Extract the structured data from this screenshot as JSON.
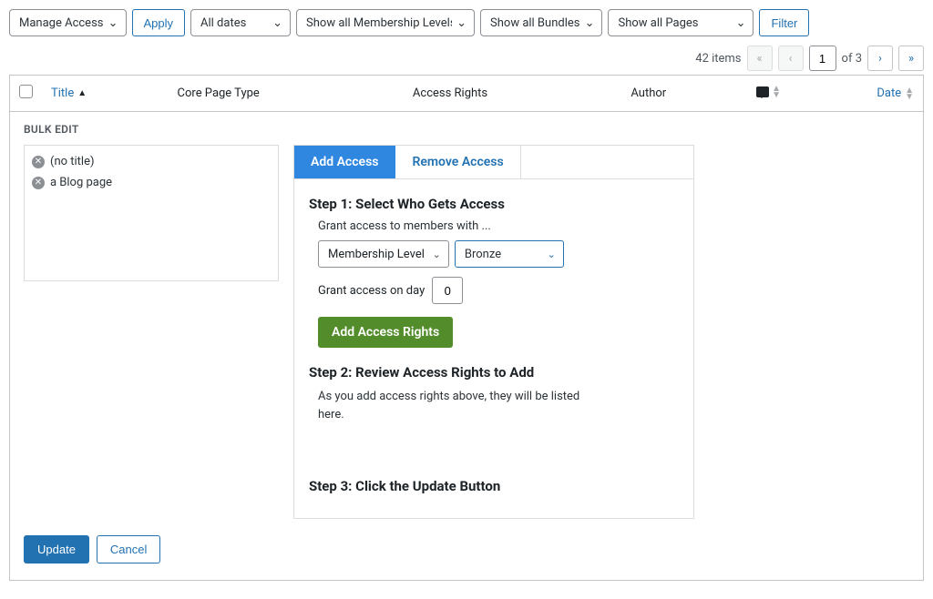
{
  "filters": {
    "bulk_action": "Manage Access",
    "apply": "Apply",
    "dates": "All dates",
    "levels": "Show all Membership Levels",
    "bundles": "Show all Bundles",
    "pages": "Show all Pages",
    "filter": "Filter"
  },
  "pagination": {
    "count": "42 items",
    "current": "1",
    "of": "of 3"
  },
  "headers": {
    "title": "Title",
    "core_type": "Core Page Type",
    "access": "Access Rights",
    "author": "Author",
    "date": "Date"
  },
  "bulk_edit": {
    "heading": "BULK EDIT",
    "items": [
      "(no title)",
      "a Blog page"
    ]
  },
  "panel": {
    "tab_add": "Add Access",
    "tab_remove": "Remove Access",
    "step1_title": "Step 1: Select Who Gets Access",
    "grant_access_to": "Grant access to members with ...",
    "who_type": "Membership Level",
    "who_value": "Bronze",
    "grant_on_day_label": "Grant access on day",
    "grant_on_day_value": "0",
    "add_rights_btn": "Add Access Rights",
    "step2_title": "Step 2: Review Access Rights to Add",
    "step2_text": "As you add access rights above, they will be listed here.",
    "step3_title": "Step 3: Click the Update Button"
  },
  "footer": {
    "update": "Update",
    "cancel": "Cancel"
  }
}
